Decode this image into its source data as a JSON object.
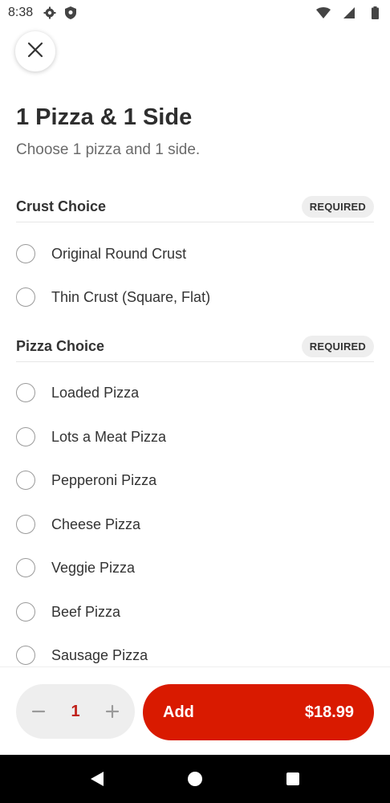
{
  "status_bar": {
    "time": "8:38",
    "icons": [
      "gear-icon",
      "shield-icon",
      "wifi-icon",
      "signal-icon",
      "battery-icon"
    ]
  },
  "close_icon": "close-icon",
  "header": {
    "title": "1 Pizza & 1 Side",
    "subtitle": "Choose 1 pizza and 1 side."
  },
  "sections": [
    {
      "title": "Crust Choice",
      "badge": "REQUIRED",
      "options": [
        "Original Round Crust",
        "Thin Crust (Square, Flat)"
      ]
    },
    {
      "title": "Pizza Choice",
      "badge": "REQUIRED",
      "options": [
        "Loaded Pizza",
        "Lots a Meat Pizza",
        "Pepperoni Pizza",
        "Cheese Pizza",
        "Veggie Pizza",
        "Beef Pizza",
        "Sausage Pizza"
      ]
    }
  ],
  "bottom_bar": {
    "quantity": "1",
    "minus_icon": "minus-icon",
    "plus_icon": "plus-icon",
    "add_label": "Add",
    "price": "$18.99"
  },
  "colors": {
    "accent": "#d91a00",
    "quantity_text": "#c0211a",
    "badge_bg": "#eeeeee"
  }
}
